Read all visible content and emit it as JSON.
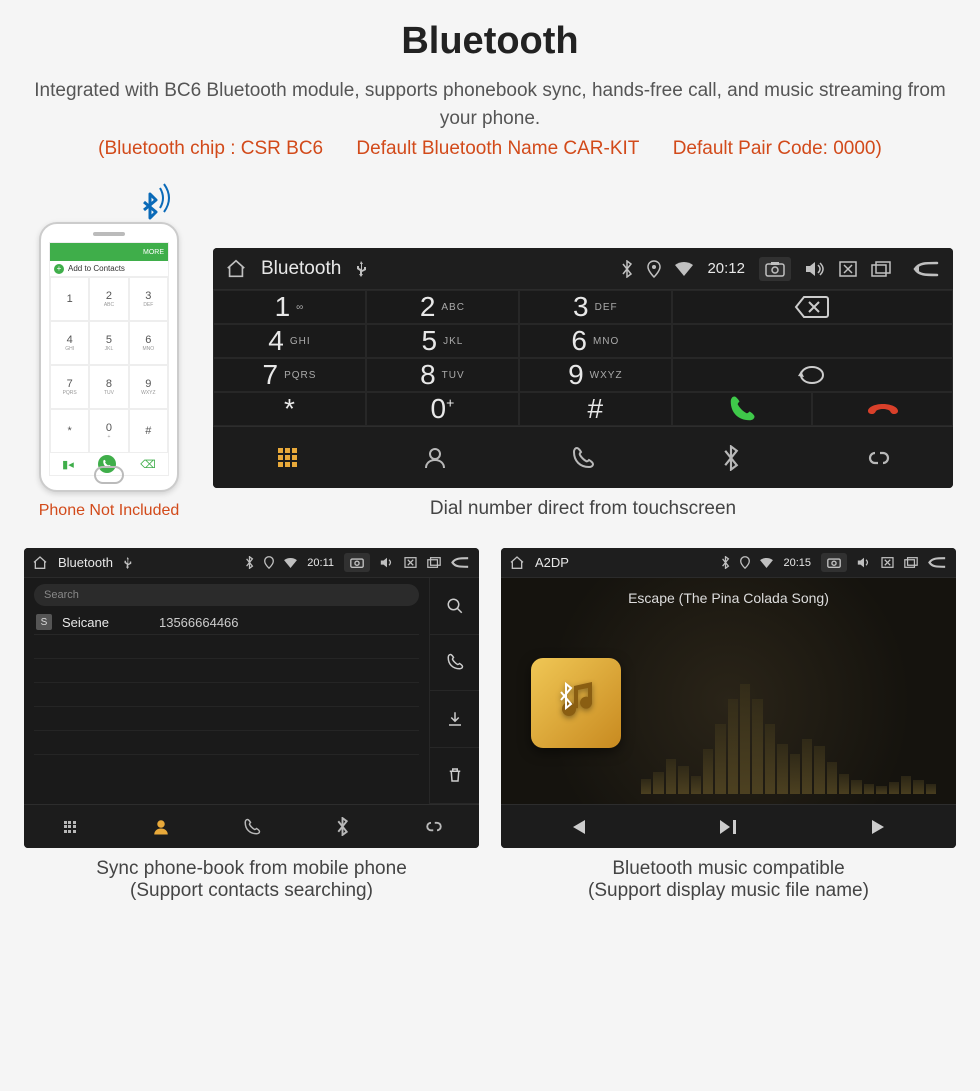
{
  "header": {
    "title": "Bluetooth",
    "subtitle": "Integrated with BC6 Bluetooth module, supports phonebook sync, hands-free call, and music streaming from your phone.",
    "spec_chip": "(Bluetooth chip : CSR BC6",
    "spec_name": "Default Bluetooth Name CAR-KIT",
    "spec_code": "Default Pair Code: 0000)"
  },
  "phone": {
    "topbar": "MORE",
    "add_label": "Add to Contacts",
    "keys": [
      {
        "n": "1",
        "s": ""
      },
      {
        "n": "2",
        "s": "ABC"
      },
      {
        "n": "3",
        "s": "DEF"
      },
      {
        "n": "4",
        "s": "GHI"
      },
      {
        "n": "5",
        "s": "JKL"
      },
      {
        "n": "6",
        "s": "MNO"
      },
      {
        "n": "7",
        "s": "PQRS"
      },
      {
        "n": "8",
        "s": "TUV"
      },
      {
        "n": "9",
        "s": "WXYZ"
      },
      {
        "n": "*",
        "s": ""
      },
      {
        "n": "0",
        "s": "+"
      },
      {
        "n": "#",
        "s": ""
      }
    ],
    "caption": "Phone Not Included"
  },
  "dialer": {
    "title": "Bluetooth",
    "time": "20:12",
    "keys": [
      {
        "n": "1",
        "s": "∞"
      },
      {
        "n": "2",
        "s": "ABC"
      },
      {
        "n": "3",
        "s": "DEF"
      },
      {
        "n": "4",
        "s": "GHI"
      },
      {
        "n": "5",
        "s": "JKL"
      },
      {
        "n": "6",
        "s": "MNO"
      },
      {
        "n": "7",
        "s": "PQRS"
      },
      {
        "n": "8",
        "s": "TUV"
      },
      {
        "n": "9",
        "s": "WXYZ"
      },
      {
        "n": "*",
        "s": ""
      },
      {
        "n": "0",
        "s": "+"
      },
      {
        "n": "#",
        "s": ""
      }
    ],
    "caption": "Dial number direct from touchscreen"
  },
  "contacts": {
    "title": "Bluetooth",
    "time": "20:11",
    "search_placeholder": "Search",
    "entry_badge": "S",
    "entry_name": "Seicane",
    "entry_number": "13566664466",
    "caption_line1": "Sync phone-book from mobile phone",
    "caption_line2": "(Support contacts searching)"
  },
  "music": {
    "title": "A2DP",
    "time": "20:15",
    "track": "Escape (The Pina Colada Song)",
    "caption_line1": "Bluetooth music compatible",
    "caption_line2": "(Support display music file name)"
  }
}
